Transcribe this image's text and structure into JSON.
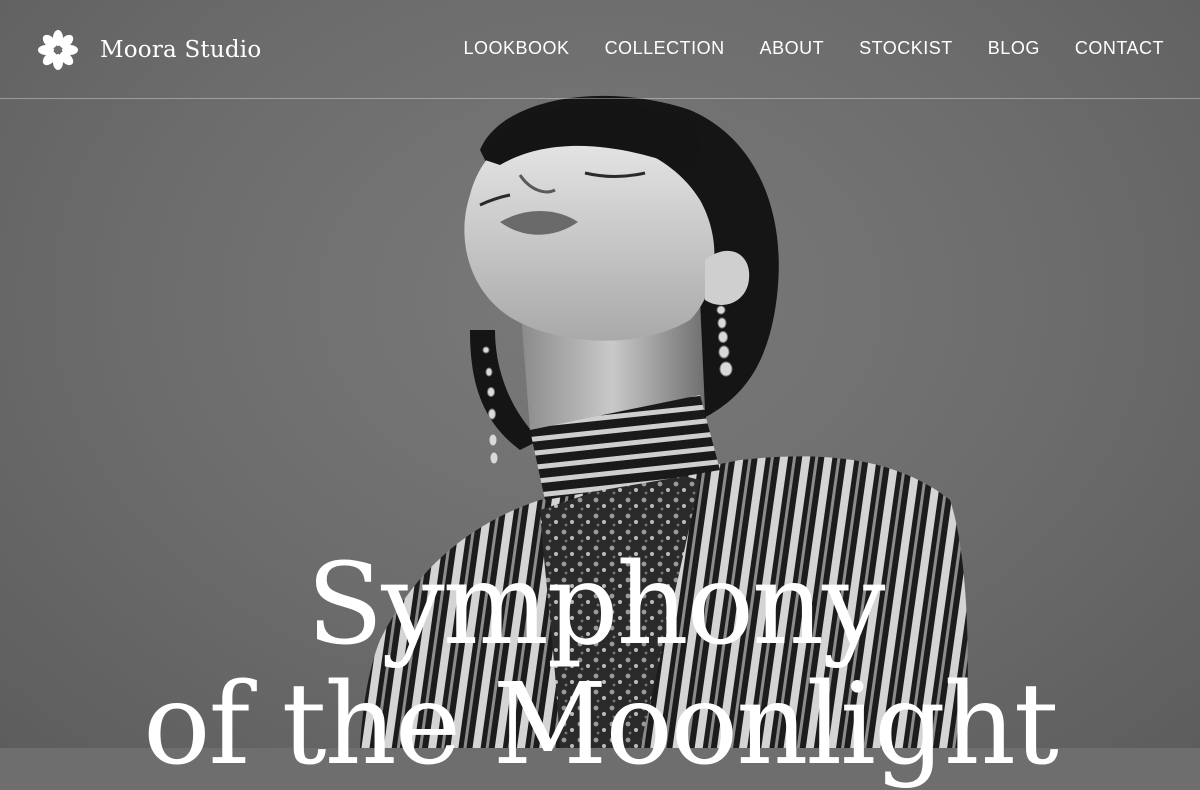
{
  "brand": {
    "name": "Moora Studio",
    "logo_icon": "flower-icon"
  },
  "nav": {
    "items": [
      {
        "label": "LOOKBOOK"
      },
      {
        "label": "COLLECTION"
      },
      {
        "label": "ABOUT"
      },
      {
        "label": "STOCKIST"
      },
      {
        "label": "BLOG"
      },
      {
        "label": "CONTACT"
      }
    ]
  },
  "hero": {
    "headline_line1": "Symphony",
    "headline_line2": "of the Moonlight",
    "image": "hero-portrait-image"
  },
  "colors": {
    "text": "#ffffff",
    "background": "#6e6e6e"
  }
}
